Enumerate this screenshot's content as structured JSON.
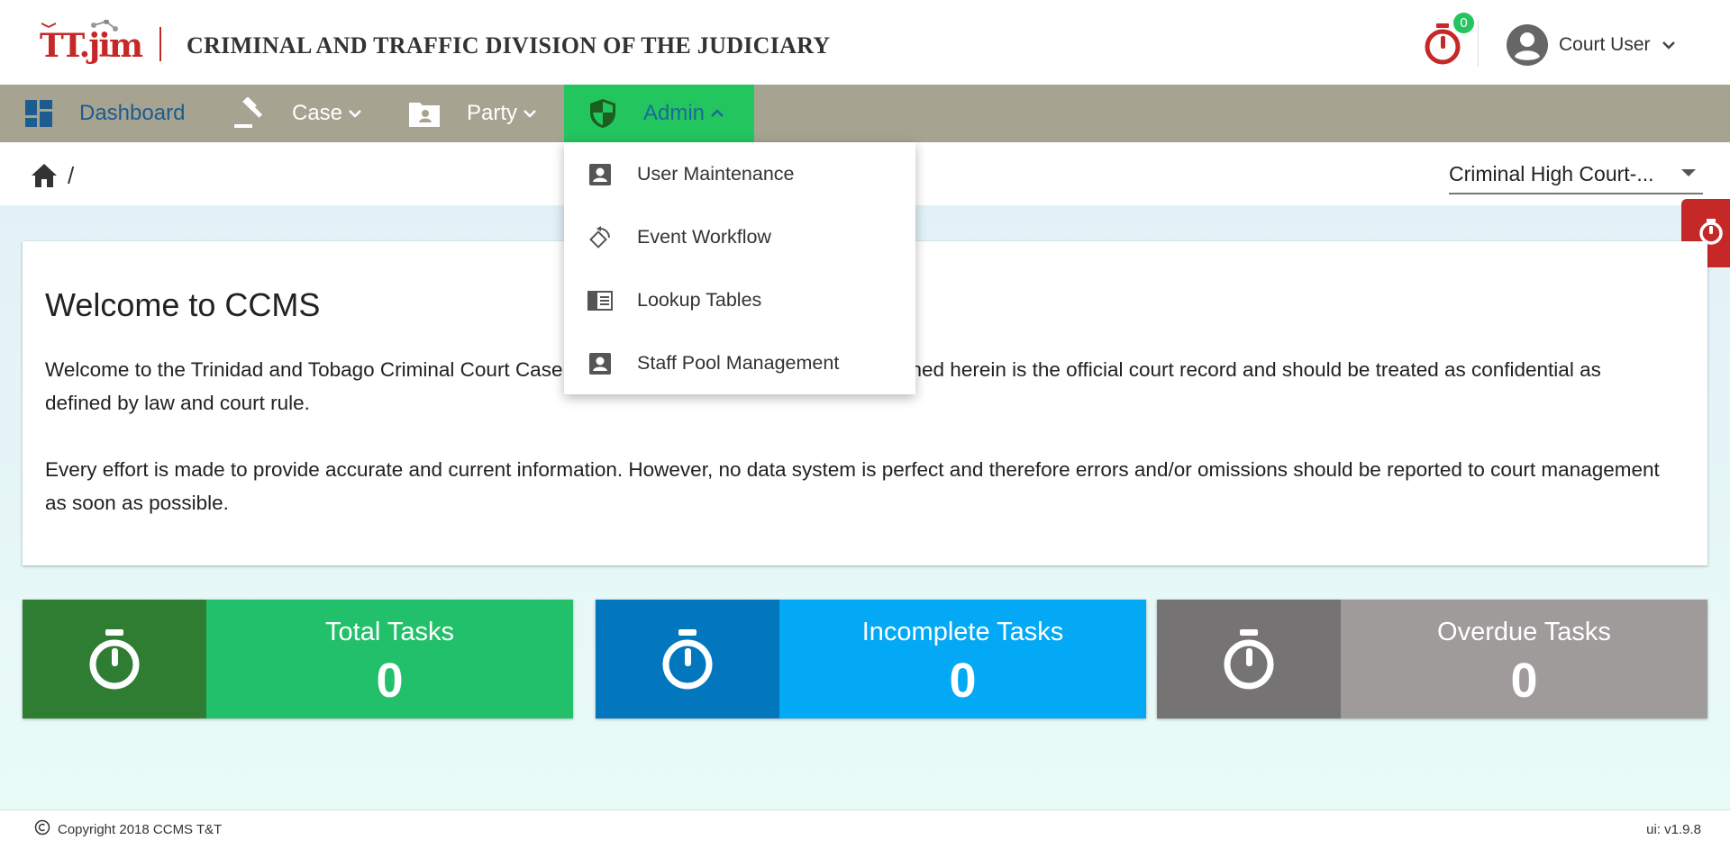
{
  "header": {
    "logo_text": "TT.jim",
    "app_title": "CRIMINAL AND TRAFFIC DIVISION OF THE JUDICIARY",
    "timer_badge": "0",
    "user_name": "Court User"
  },
  "nav": {
    "dashboard": "Dashboard",
    "case": "Case",
    "party": "Party",
    "admin": "Admin"
  },
  "admin_menu": [
    {
      "label": "User Maintenance",
      "icon": "contact-icon"
    },
    {
      "label": "Event Workflow",
      "icon": "workflow-icon"
    },
    {
      "label": "Lookup Tables",
      "icon": "table-icon"
    },
    {
      "label": "Staff Pool Management",
      "icon": "contact-icon"
    }
  ],
  "breadcrumb": {
    "separator": "/"
  },
  "court_select": {
    "value": "Criminal High Court-..."
  },
  "welcome": {
    "title": "Welcome to CCMS",
    "paragraph1": "Welcome to the Trinidad and Tobago Criminal Court Case Management System. The data contained herein is the official court record and should be treated as confidential as defined by law and court rule.",
    "paragraph2": "Every effort is made to provide accurate and current information. However, no data system is perfect and therefore errors and/or omissions should be reported to court management as soon as possible."
  },
  "tasks": [
    {
      "title": "Total Tasks",
      "value": "0",
      "color": "#22c06a",
      "dark": "#2e7d32"
    },
    {
      "title": "Incomplete Tasks",
      "value": "0",
      "color": "#03a9f4",
      "dark": "#0277bd"
    },
    {
      "title": "Overdue Tasks",
      "value": "0",
      "color": "#9e9b9a",
      "dark": "#757373"
    }
  ],
  "footer": {
    "copyright": "Copyright 2018  CCMS T&T",
    "version": "ui: v1.9.8"
  },
  "colors": {
    "navbar": "#a6a391",
    "admin_active": "#22c55e",
    "brand_red": "#c62828"
  }
}
